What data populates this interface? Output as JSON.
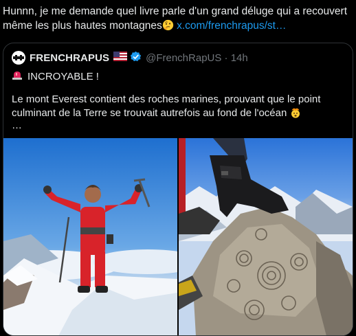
{
  "tweet": {
    "text": "Hunnn, je me demande quel livre parle d'un grand déluge qui a recouvert même les plus hautes montagnes",
    "emoji": "thinking-face-emoji",
    "link": "x.com/frenchrapus/st…"
  },
  "quoted": {
    "name": "FRENCHRAPUS",
    "flag": "us-flag-emoji",
    "handle": "@FrenchRapUS · 14h",
    "alert_icon": "siren-emoji",
    "alert_text": "INCROYABLE !",
    "body": "Le mont Everest contient des roches marines, prouvant que le point culminant de la Terre se trouvait autrefois au fond de l'océan",
    "body_emoji": "exploding-head-emoji",
    "more": "…",
    "media": [
      {
        "description": "climber-summit-photo"
      },
      {
        "description": "fossil-rock-photo"
      }
    ]
  },
  "colors": {
    "background": "#000000",
    "text": "#e7e9ea",
    "secondary": "#71767b",
    "link": "#1d9bf0",
    "border": "#2f3336",
    "verified": "#1d9bf0"
  }
}
